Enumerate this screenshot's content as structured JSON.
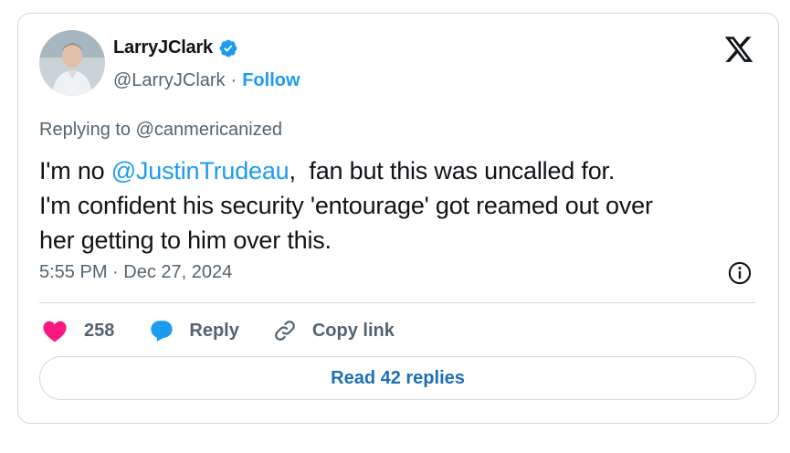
{
  "author": {
    "display_name": "LarryJClark",
    "handle": "@LarryJClark",
    "separator": "·",
    "follow_label": "Follow",
    "verified": true
  },
  "tweet": {
    "replying_to": "Replying to @canmericanized",
    "lines": [
      {
        "pre": "I'm no ",
        "mention": "@JustinTrudeau",
        "post": ",  fan but this was uncalled for."
      },
      {
        "text": "I'm confident his security 'entourage' got reamed out over"
      },
      {
        "text": "her getting to him over this."
      }
    ],
    "timestamp": "5:55 PM · Dec 27, 2024"
  },
  "actions": {
    "like_count": "258",
    "reply_label": "Reply",
    "copy_label": "Copy link"
  },
  "read_replies_label": "Read 42 replies",
  "icons": {
    "logo": "x-logo-icon",
    "verified": "verified-badge-icon",
    "info": "info-icon",
    "like": "heart-icon",
    "reply": "speech-bubble-icon",
    "copy": "link-icon"
  },
  "colors": {
    "accent": "#1d9bf0",
    "like": "#f91880",
    "text": "#0f1419",
    "secondary": "#536471",
    "border": "#cfd9de"
  }
}
